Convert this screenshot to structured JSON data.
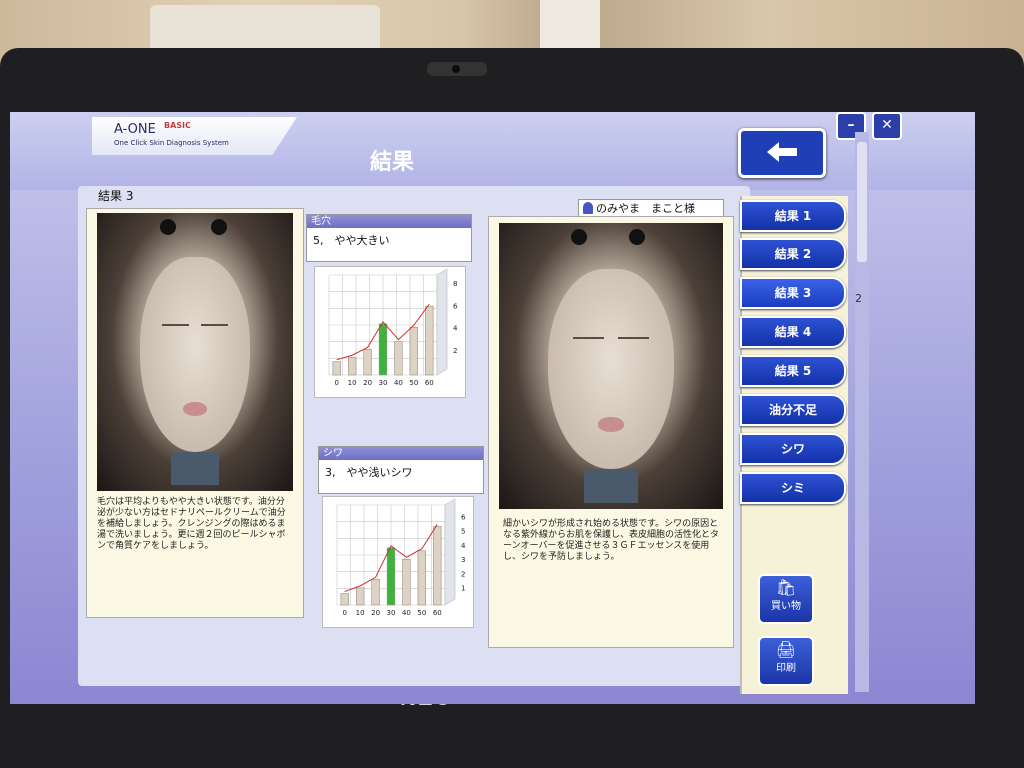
{
  "app": {
    "brand_name": "A-ONE",
    "brand_edition": "BASIC",
    "brand_tagline": "One Click Skin Diagnosis System",
    "page_title": "結果",
    "back_icon": "left-arrow-icon",
    "minimize_symbol": "–",
    "close_symbol": "✕",
    "device_logo": "NEC"
  },
  "panel": {
    "tag": "結果 3",
    "user_name": "のみやま　まこと様",
    "side_marker": "2"
  },
  "pores": {
    "label": "毛穴",
    "value": "5,　やや大きい",
    "description": "毛穴は平均よりもやや大きい状態です。油分分泌が少ない方はセドナリペールクリームで油分を補給しましょう。クレンジングの際はめるま湯で洗いましょう。更に週２回のピールシャボンで角質ケアをしましょう。"
  },
  "wrinkles": {
    "label": "シワ",
    "value": "3,　やや浅いシワ",
    "description": "細かいシワが形成され始める状態です。シワの原因となる紫外線からお肌を保護し、表皮細胞の活性化とターンオーバーを促進させる３ＧＦエッセンスを使用し、シワを予防しましょう。"
  },
  "chart_data": [
    {
      "type": "bar",
      "categories": [
        "0",
        "10",
        "20",
        "30",
        "40",
        "50",
        "60"
      ],
      "values": [
        1.2,
        1.6,
        2.3,
        4.6,
        3.0,
        4.3,
        6.2
      ],
      "highlight_index": 3,
      "y_ticks": [
        "2",
        "4",
        "6",
        "8"
      ],
      "ylim": [
        0,
        9
      ],
      "trend_line": true,
      "colors": {
        "bar": "#ddd3c4",
        "highlight": "#3cb33c",
        "trend": "#cc3333"
      }
    },
    {
      "type": "bar",
      "categories": [
        "0",
        "10",
        "20",
        "30",
        "40",
        "50",
        "60"
      ],
      "values": [
        0.8,
        1.2,
        1.8,
        4.0,
        3.2,
        3.8,
        5.5
      ],
      "highlight_index": 3,
      "y_ticks": [
        "1",
        "2",
        "3",
        "4",
        "5",
        "6"
      ],
      "ylim": [
        0,
        7
      ],
      "trend_line": true,
      "colors": {
        "bar": "#ddd3c4",
        "highlight": "#3cb33c",
        "trend": "#cc3333"
      }
    }
  ],
  "nav": {
    "items": [
      "結果 1",
      "結果 2",
      "結果 3",
      "結果 4",
      "結果 5",
      "油分不足",
      "シワ",
      "シミ"
    ],
    "active_index": 2,
    "shop_label": "買い物",
    "shop_icon": "shopping-bag-icon",
    "print_label": "印刷",
    "print_icon": "printer-icon"
  }
}
